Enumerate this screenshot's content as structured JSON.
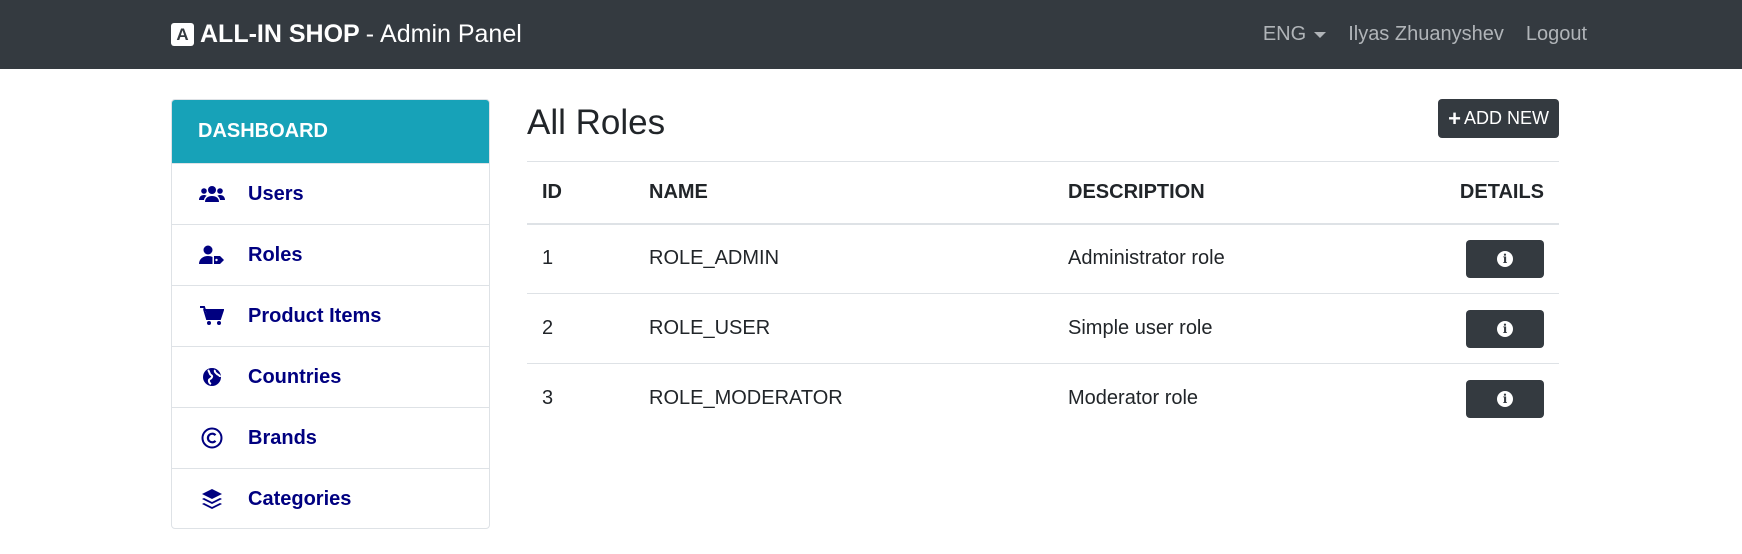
{
  "navbar": {
    "logo_letter": "A",
    "brand_name": "ALL-IN SHOP",
    "brand_separator": "-",
    "brand_subtitle": "Admin Panel",
    "language": "ENG",
    "user_name": "Ilyas Zhuanyshev",
    "logout_label": "Logout"
  },
  "sidebar": {
    "header": "DASHBOARD",
    "items": [
      {
        "label": "Users",
        "icon": "users-icon"
      },
      {
        "label": "Roles",
        "icon": "user-tag-icon"
      },
      {
        "label": "Product Items",
        "icon": "cart-icon"
      },
      {
        "label": "Countries",
        "icon": "globe-icon"
      },
      {
        "label": "Brands",
        "icon": "copyright-icon"
      },
      {
        "label": "Categories",
        "icon": "layers-icon"
      }
    ]
  },
  "main": {
    "title": "All Roles",
    "add_button_icon": "+",
    "add_button_label": "ADD NEW",
    "table": {
      "headers": [
        "ID",
        "NAME",
        "DESCRIPTION",
        "DETAILS"
      ],
      "rows": [
        {
          "id": "1",
          "name": "ROLE_ADMIN",
          "description": "Administrator role"
        },
        {
          "id": "2",
          "name": "ROLE_USER",
          "description": "Simple user role"
        },
        {
          "id": "3",
          "name": "ROLE_MODERATOR",
          "description": "Moderator role"
        }
      ],
      "details_icon_glyph": "i"
    }
  },
  "colors": {
    "navbar_bg": "#343a40",
    "sidebar_header_bg": "#17a2b8",
    "sidebar_link": "#000080",
    "button_dark": "#343a40"
  }
}
